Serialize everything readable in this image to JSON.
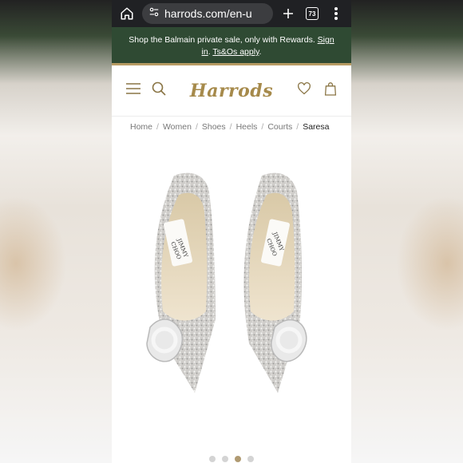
{
  "browser": {
    "url": "harrods.com/en-u",
    "tab_count": "73"
  },
  "promo": {
    "text_prefix": "Shop the Balmain private sale, only with Rewards. ",
    "sign_in": "Sign in",
    "text_mid": ". ",
    "terms": "Ts&Os apply",
    "text_suffix": "."
  },
  "header": {
    "logo": "Harrods"
  },
  "breadcrumb": {
    "items": [
      "Home",
      "Women",
      "Shoes",
      "Heels",
      "Courts"
    ],
    "current": "Saresa"
  },
  "product": {
    "brand_label_top": "JIMMY",
    "brand_label_bottom": "CHOO"
  },
  "gallery": {
    "total": 4,
    "active_index": 3
  },
  "colors": {
    "promo_bg": "#2f4a33",
    "gold_accent": "#a68a4b",
    "browser_bg": "#202124"
  }
}
